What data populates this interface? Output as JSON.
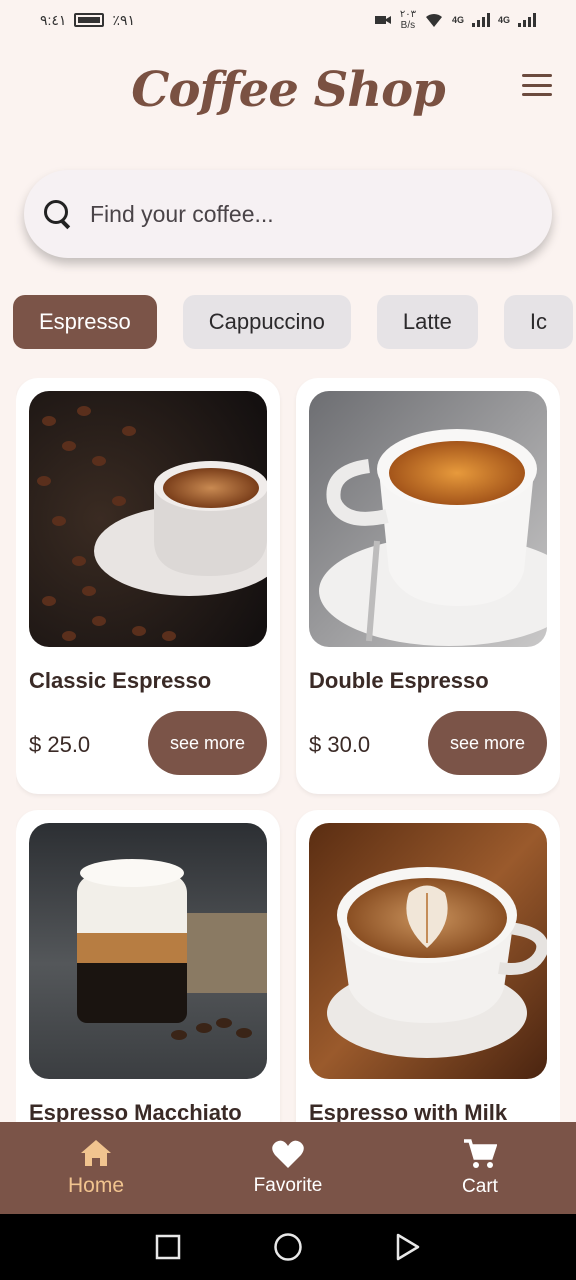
{
  "status_bar": {
    "time": "٩:٤١",
    "battery": "٪٩١",
    "net_speed_value": "٢٠٣",
    "net_speed_unit": "B/s",
    "network_1": "4G",
    "network_2": "4G"
  },
  "header": {
    "title": "Coffee Shop",
    "menu_icon": "hamburger-menu-icon"
  },
  "search": {
    "placeholder": "Find your coffee...",
    "icon": "search-icon"
  },
  "categories": [
    {
      "label": "Espresso",
      "active": true
    },
    {
      "label": "Cappuccino",
      "active": false
    },
    {
      "label": "Latte",
      "active": false
    },
    {
      "label": "Ic",
      "active": false
    }
  ],
  "products": [
    {
      "name": "Classic Espresso",
      "price": "$ 25.0",
      "button": "see more"
    },
    {
      "name": "Double Espresso",
      "price": "$ 30.0",
      "button": "see more"
    },
    {
      "name": "Espresso Macchiato",
      "price": "",
      "button": ""
    },
    {
      "name": "Espresso with Milk",
      "price": "",
      "button": ""
    }
  ],
  "bottom_nav": [
    {
      "label": "Home",
      "icon": "home-icon",
      "active": true
    },
    {
      "label": "Favorite",
      "icon": "heart-icon",
      "active": false
    },
    {
      "label": "Cart",
      "icon": "cart-icon",
      "active": false
    }
  ],
  "colors": {
    "accent": "#7b5448",
    "background": "#fbf3f0",
    "active_nav": "#f1c48f"
  }
}
